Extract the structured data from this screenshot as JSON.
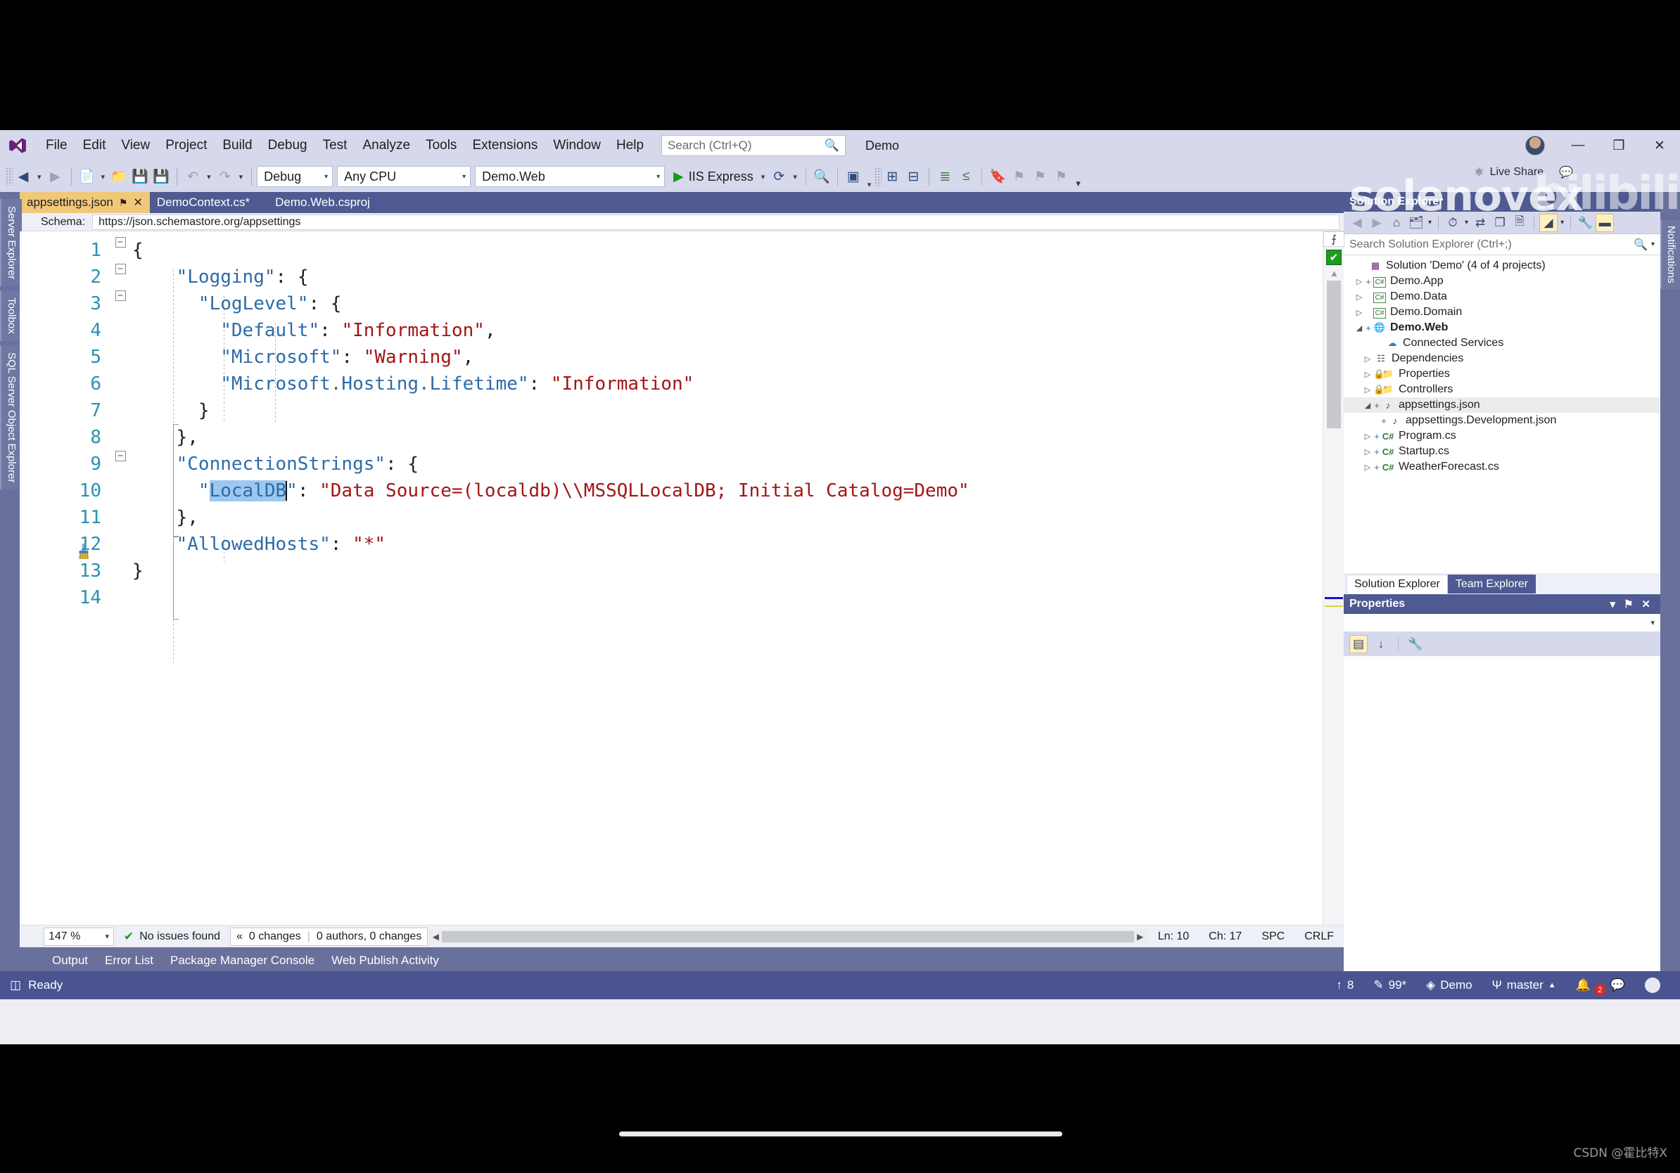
{
  "app": {
    "logo_icon": "visual-studio-logo",
    "solution_name": "Demo",
    "avatar": "user-avatar"
  },
  "menubar": {
    "items": [
      "File",
      "Edit",
      "View",
      "Project",
      "Build",
      "Debug",
      "Test",
      "Analyze",
      "Tools",
      "Extensions",
      "Window",
      "Help"
    ],
    "search_placeholder": "Search (Ctrl+Q)",
    "search_icon": "search-icon",
    "minimize_icon": "—",
    "maximize_icon": "❐",
    "close_icon": "✕"
  },
  "toolbar": {
    "nav_back_icon": "◀",
    "nav_forward_icon": "▶",
    "new_project_icon": "new-project-icon",
    "open_icon": "open-folder-icon",
    "save_icon": "save-icon",
    "save_all_icon": "save-all-icon",
    "undo_icon": "↶",
    "redo_icon": "↷",
    "config_value": "Debug",
    "platform_value": "Any CPU",
    "startup_project_value": "Demo.Web",
    "run_icon": "▶",
    "run_label": "IIS Express",
    "refresh_icon": "⟳",
    "find_icon": "find-icon",
    "preview_icon": "preview-icon",
    "comment_icon": "comment-icon",
    "uncomment_icon": "uncomment-icon",
    "indent_icon": "increase-indent-icon",
    "outdent_icon": "decrease-indent-icon",
    "bookmark_icon": "bookmark-icon",
    "overflow_icon": "▾"
  },
  "left_dock": {
    "tabs": [
      "Server Explorer",
      "Toolbox",
      "SQL Server Object Explorer"
    ]
  },
  "right_dock_edge": {
    "tabs": [
      "Notifications"
    ]
  },
  "document_tabs": [
    {
      "label": "appsettings.json",
      "active": true,
      "pin_icon": "⚑",
      "close_icon": "✕"
    },
    {
      "label": "DemoContext.cs*",
      "active": false
    },
    {
      "label": "Demo.Web.csproj",
      "active": false
    }
  ],
  "schema_bar": {
    "label": "Schema:",
    "value": "https://json.schemastore.org/appsettings"
  },
  "editor": {
    "glyph_icon": "broom-icon",
    "lines": [
      {
        "num": "1",
        "fold": "minus",
        "indent": 0,
        "text": "{"
      },
      {
        "num": "2",
        "fold": "minus",
        "indent": 1,
        "text": "\"Logging\": {"
      },
      {
        "num": "3",
        "fold": "minus",
        "indent": 2,
        "text": "\"LogLevel\": {"
      },
      {
        "num": "4",
        "fold": "",
        "indent": 3,
        "text": "\"Default\": \"Information\","
      },
      {
        "num": "5",
        "fold": "",
        "indent": 3,
        "text": "\"Microsoft\": \"Warning\","
      },
      {
        "num": "6",
        "fold": "",
        "indent": 3,
        "text": "\"Microsoft.Hosting.Lifetime\": \"Information\""
      },
      {
        "num": "7",
        "fold": "",
        "indent": 2,
        "text": "}"
      },
      {
        "num": "8",
        "fold": "",
        "indent": 1,
        "text": "},"
      },
      {
        "num": "9",
        "fold": "minus",
        "indent": 1,
        "text": "\"ConnectionStrings\": {"
      },
      {
        "num": "10",
        "fold": "",
        "indent": 2,
        "text": "\"LocalDB\": \"Data Source=(localdb)\\\\MSSQLLocalDB; Initial Catalog=Demo\""
      },
      {
        "num": "11",
        "fold": "",
        "indent": 1,
        "text": "},"
      },
      {
        "num": "12",
        "fold": "",
        "indent": 1,
        "text": "\"AllowedHosts\": \"*\""
      },
      {
        "num": "13",
        "fold": "",
        "indent": 0,
        "text": "}"
      },
      {
        "num": "14",
        "fold": "",
        "indent": 0,
        "text": ""
      }
    ],
    "selected_token": "LocalDB",
    "health_icon": "✔",
    "splitter_icon": "⨍",
    "scroll_up_icon": "▲"
  },
  "editor_status": {
    "zoom": "147 %",
    "zoom_caret": "▾",
    "issues_icon": "✔",
    "issues_text": "No issues found",
    "changes_icon": "«",
    "changes_text": "0 changes",
    "authors_text": "0 authors, 0 changes",
    "scroll_left_icon": "◀",
    "scroll_right_icon": "▶",
    "line": "Ln: 10",
    "col": "Ch: 17",
    "spaces": "SPC",
    "eol": "CRLF"
  },
  "tool_tabs": [
    "Output",
    "Error List",
    "Package Manager Console",
    "Web Publish Activity"
  ],
  "solution_explorer": {
    "title": "Solution Explorer",
    "toolbar_icons": [
      "back-icon",
      "forward-icon",
      "home-icon",
      "pending-changes-icon",
      "history-icon",
      "sync-icon",
      "collapse-all-icon",
      "show-all-files-icon",
      "properties-window-icon",
      "preview-selected-items-icon"
    ],
    "search_placeholder": "Search Solution Explorer (Ctrl+;)",
    "search_icon": "search-icon",
    "tree": [
      {
        "depth": 0,
        "chevron": "",
        "plus": "",
        "icon": "solution-icon",
        "label": "Solution 'Demo' (4 of 4 projects)",
        "bold": false,
        "selected": false
      },
      {
        "depth": 1,
        "chevron": "▷",
        "plus": "+",
        "icon": "csharp-project-icon",
        "label": "Demo.App",
        "bold": false,
        "selected": false
      },
      {
        "depth": 1,
        "chevron": "▷",
        "plus": "",
        "icon": "csharp-project-icon",
        "label": "Demo.Data",
        "bold": false,
        "selected": false
      },
      {
        "depth": 1,
        "chevron": "▷",
        "plus": "",
        "icon": "csharp-project-icon",
        "label": "Demo.Domain",
        "bold": false,
        "selected": false
      },
      {
        "depth": 1,
        "chevron": "◢",
        "plus": "+",
        "icon": "web-project-icon",
        "label": "Demo.Web",
        "bold": true,
        "selected": false
      },
      {
        "depth": 2,
        "chevron": "",
        "plus": "",
        "icon": "connected-services-icon",
        "label": "Connected Services",
        "bold": false,
        "selected": false
      },
      {
        "depth": 2,
        "chevron": "▷",
        "plus": "",
        "icon": "dependencies-icon",
        "label": "Dependencies",
        "bold": false,
        "selected": false
      },
      {
        "depth": 2,
        "chevron": "▷",
        "plus": "",
        "icon": "properties-folder-icon",
        "label": "Properties",
        "bold": false,
        "selected": false
      },
      {
        "depth": 2,
        "chevron": "▷",
        "plus": "",
        "icon": "folder-icon",
        "label": "Controllers",
        "bold": false,
        "selected": false
      },
      {
        "depth": 2,
        "chevron": "◢",
        "plus": "+",
        "icon": "json-file-icon",
        "label": "appsettings.json",
        "bold": false,
        "selected": true
      },
      {
        "depth": 3,
        "chevron": "",
        "plus": "+",
        "icon": "json-file-icon",
        "label": "appsettings.Development.json",
        "bold": false,
        "selected": false
      },
      {
        "depth": 2,
        "chevron": "▷",
        "plus": "+",
        "icon": "csharp-file-icon",
        "label": "Program.cs",
        "bold": false,
        "selected": false
      },
      {
        "depth": 2,
        "chevron": "▷",
        "plus": "+",
        "icon": "csharp-file-icon",
        "label": "Startup.cs",
        "bold": false,
        "selected": false
      },
      {
        "depth": 2,
        "chevron": "▷",
        "plus": "+",
        "icon": "csharp-file-icon",
        "label": "WeatherForecast.cs",
        "bold": false,
        "selected": false
      }
    ],
    "dock_tabs": [
      {
        "label": "Solution Explorer",
        "active": true
      },
      {
        "label": "Team Explorer",
        "active": false
      }
    ]
  },
  "properties_panel": {
    "title": "Properties",
    "dropdown_icon": "▾",
    "pin_icon": "⚑",
    "close_icon": "✕",
    "combo_caret": "▾",
    "categorized_icon": "categorized-view-icon",
    "alphabetical_icon": "alphabetical-sort-icon",
    "events_icon": "wrench-icon"
  },
  "status_bar": {
    "ready_icon": "ready-icon",
    "ready_text": "Ready",
    "up_icon": "↑",
    "up_count": "8",
    "pencil_icon": "✎",
    "pencil_count": "99*",
    "repo_icon": "◈",
    "repo_name": "Demo",
    "branch_icon": "Ψ",
    "branch_name": "master",
    "branch_caret": "▲",
    "notification_icon": "🔔",
    "notification_count": "2",
    "feedback_icon": "feedback-icon",
    "addmore_icon": "add-to-source-control-icon"
  },
  "live_share": {
    "icon": "live-share-icon",
    "label": "Live Share",
    "share_icon": "share-icon"
  },
  "watermarks": {
    "solenovex": "solenovex",
    "bilibili": "bilibili",
    "csdn": "CSDN @霍比特X"
  }
}
